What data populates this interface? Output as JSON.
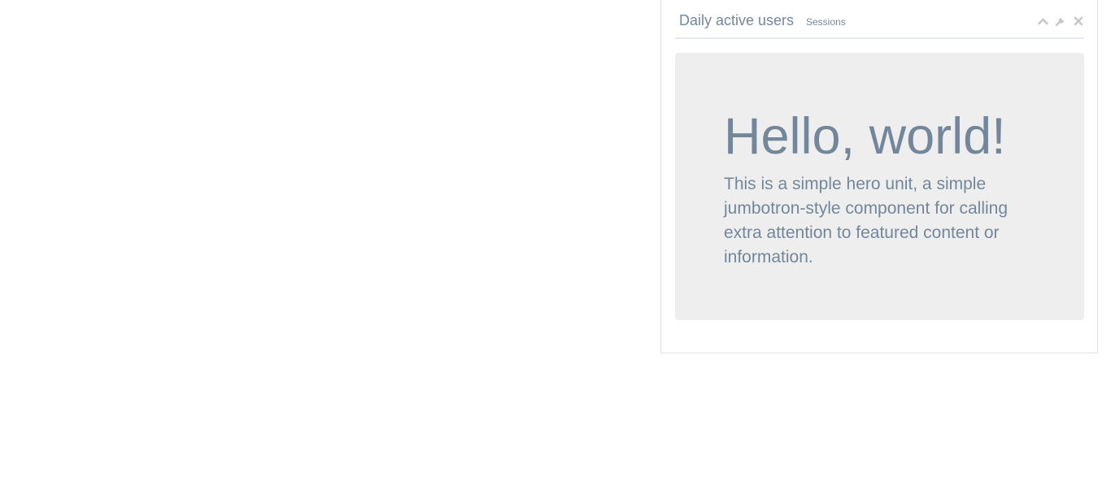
{
  "panel": {
    "title": "Daily active users",
    "subtitle": "Sessions",
    "tools": [
      "chevron-up-icon",
      "wrench-icon",
      "close-icon"
    ],
    "colors": {
      "text": "#73879c",
      "tool_icon": "#c5c7cb",
      "jumbotron_bg": "#eeeeee",
      "border": "#e6e9ed"
    }
  },
  "jumbotron": {
    "heading": "Hello, world!",
    "text": "This is a simple hero unit, a simple jumbotron-style component for calling extra attention to featured content or information."
  }
}
